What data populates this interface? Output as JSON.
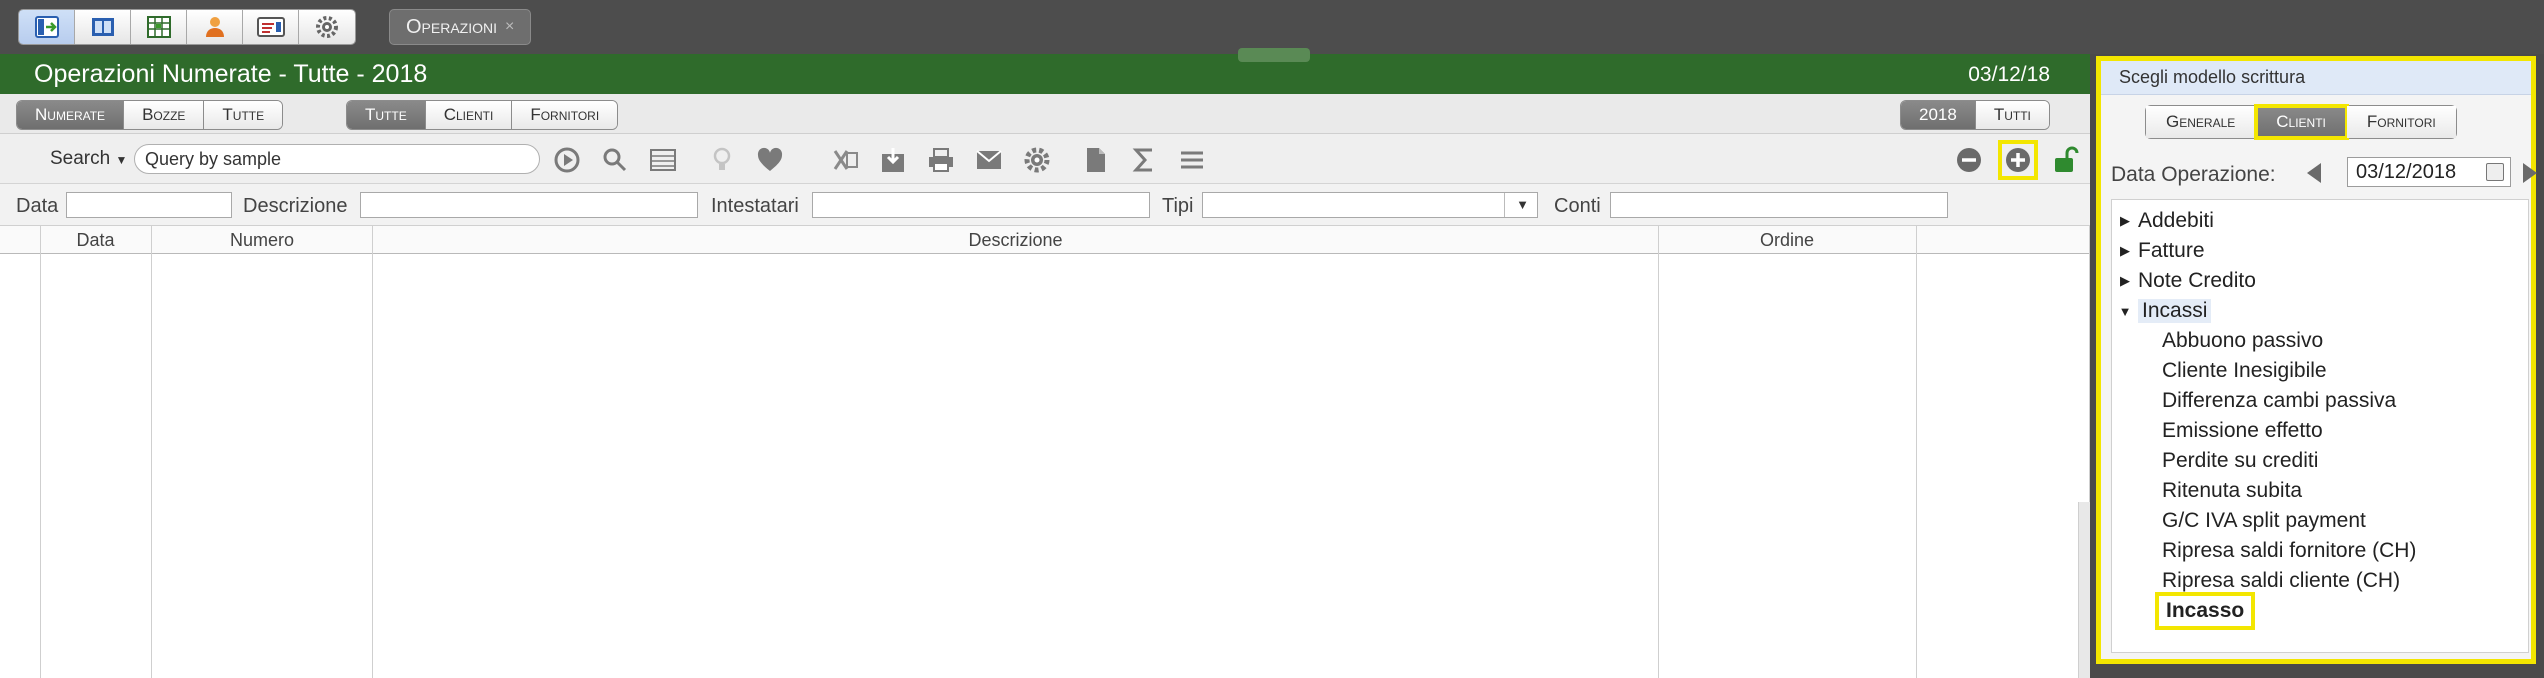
{
  "topbar": {
    "app_icons": [
      "import-icon",
      "ledger-icon",
      "spreadsheet-icon",
      "user-icon",
      "card-icon",
      "gear-icon"
    ],
    "tab_label": "Operazioni",
    "tab_close": "×"
  },
  "main": {
    "title": "Operazioni Numerate - Tutte - 2018",
    "date": "03/12/18"
  },
  "filters": {
    "group1": [
      "Numerate",
      "Bozze",
      "Tutte"
    ],
    "group2": [
      "Tutte",
      "Clienti",
      "Fornitori"
    ],
    "year": "2018",
    "all": "Tutti"
  },
  "toolbar": {
    "search_label": "Search",
    "search_value": "Query by sample"
  },
  "column_filters": {
    "data": "Data",
    "descrizione": "Descrizione",
    "intestatari": "Intestatari",
    "tipi": "Tipi",
    "conti": "Conti"
  },
  "grid": {
    "columns": [
      "Data",
      "Numero",
      "Descrizione",
      "Ordine"
    ]
  },
  "side": {
    "header": "Scegli modello scrittura",
    "tabs": [
      "Generale",
      "Clienti",
      "Fornitori"
    ],
    "date_label": "Data Operazione:",
    "date_value": "03/12/2018",
    "tree": {
      "collapsed": [
        "Addebiti",
        "Fatture",
        "Note Credito"
      ],
      "open": "Incassi",
      "children": [
        "Abbuono passivo",
        "Cliente Inesigibile",
        "Differenza cambi passiva",
        "Emissione effetto",
        "Perdite su crediti",
        "Ritenuta subita",
        "G/C IVA split payment",
        "Ripresa saldi fornitore (CH)",
        "Ripresa saldi cliente (CH)",
        "Incasso"
      ]
    }
  }
}
